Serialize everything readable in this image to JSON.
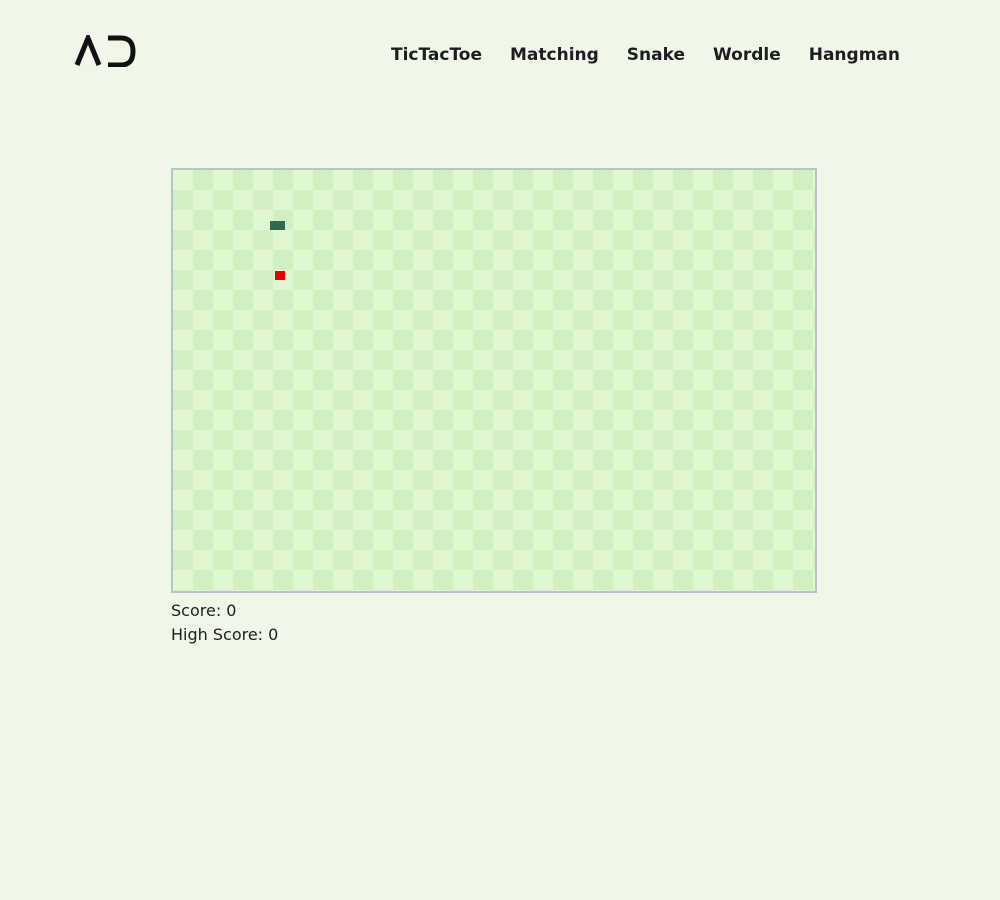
{
  "header": {
    "logo_text": "AD",
    "nav": [
      {
        "label": "TicTacToe"
      },
      {
        "label": "Matching"
      },
      {
        "label": "Snake"
      },
      {
        "label": "Wordle"
      },
      {
        "label": "Hangman"
      }
    ]
  },
  "game": {
    "name": "Snake",
    "colors": {
      "page_background": "#f0f7e9",
      "board_light": "#e0f8d2",
      "board_dark": "#d1efc1",
      "board_border": "#b9c3cc",
      "snake": "#356651",
      "food": "#e60000"
    },
    "score_label": "Score: 0",
    "high_score_label": "High Score: 0",
    "score": 0,
    "high_score": 0
  }
}
